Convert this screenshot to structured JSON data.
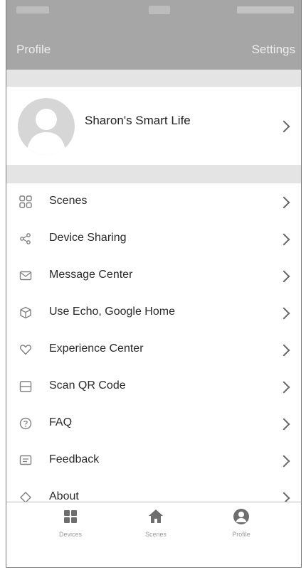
{
  "header": {
    "left_label": "Profile",
    "right_label": "Settings"
  },
  "profile": {
    "name": "Sharon's Smart Life"
  },
  "menu": {
    "items": [
      {
        "label": "Scenes",
        "icon": "scenes-icon"
      },
      {
        "label": "Device Sharing",
        "icon": "share-icon"
      },
      {
        "label": "Message Center",
        "icon": "mail-icon"
      },
      {
        "label": "Use Echo, Google Home",
        "icon": "cube-icon"
      },
      {
        "label": "Experience Center",
        "icon": "heart-icon"
      },
      {
        "label": "Scan QR Code",
        "icon": "scan-icon"
      },
      {
        "label": "FAQ",
        "icon": "help-icon"
      },
      {
        "label": "Feedback",
        "icon": "feedback-icon"
      },
      {
        "label": "About",
        "icon": "about-icon"
      }
    ]
  },
  "tabs": [
    {
      "label": "Devices",
      "icon": "grid-icon"
    },
    {
      "label": "Scenes",
      "icon": "home-icon"
    },
    {
      "label": "Profile",
      "icon": "person-icon",
      "active": true
    }
  ],
  "colors": {
    "header_bg": "#a6a6a6",
    "separator_bg": "#e4e4e4",
    "icon_gray": "#808080"
  }
}
